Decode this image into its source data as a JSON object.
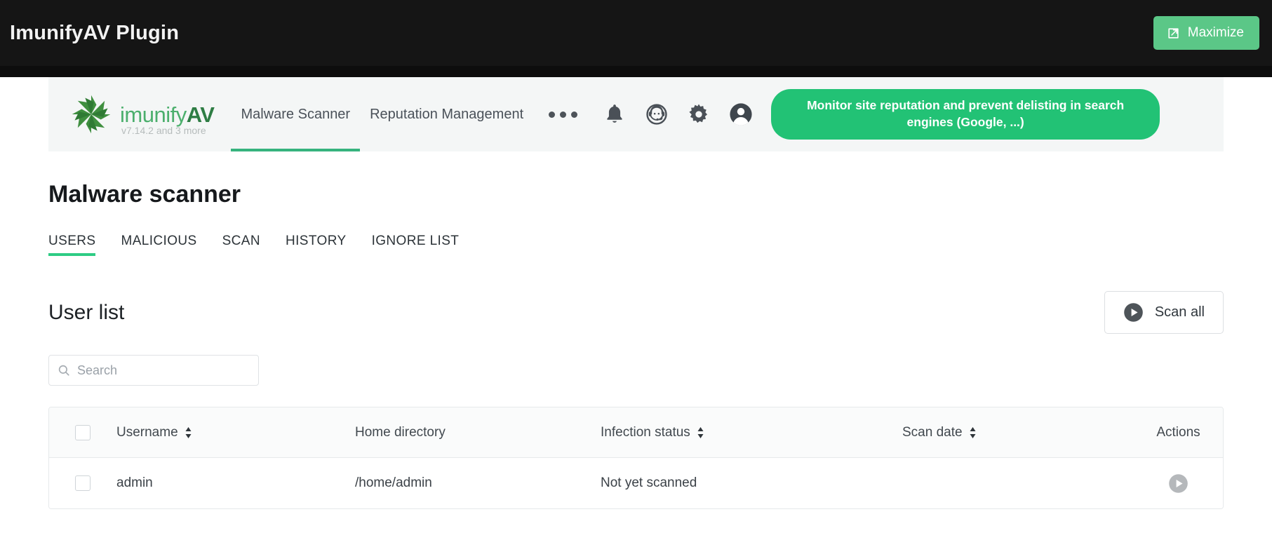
{
  "window": {
    "title": "ImunifyAV Plugin",
    "maximize_label": "Maximize",
    "maximize_icon": "expand-icon",
    "bar_bg": "#151515",
    "accent": "#5bc787"
  },
  "app_header": {
    "logo": {
      "mark_icon": "imunify-pinwheel-logo",
      "name_primary": "imunify",
      "name_secondary": "AV",
      "version": "v7.14.2 and 3 more",
      "primary_color": "#4caf6d",
      "secondary_color": "#2e7d44"
    },
    "nav": [
      {
        "label": "Malware Scanner",
        "active": true
      },
      {
        "label": "Reputation Management",
        "active": false
      }
    ],
    "more_icon": "ellipsis-icon",
    "icons": [
      {
        "name": "bell-icon"
      },
      {
        "name": "support-headset-icon"
      },
      {
        "name": "gear-icon"
      },
      {
        "name": "user-avatar-icon"
      }
    ],
    "promo": {
      "text": "Monitor site reputation and prevent delisting in search engines (Google, ...)",
      "color": "#22c275"
    }
  },
  "main": {
    "page_title": "Malware scanner",
    "tabs": [
      {
        "label": "USERS",
        "active": true
      },
      {
        "label": "MALICIOUS",
        "active": false
      },
      {
        "label": "SCAN",
        "active": false
      },
      {
        "label": "HISTORY",
        "active": false
      },
      {
        "label": "IGNORE LIST",
        "active": false
      }
    ],
    "section_title": "User list",
    "scan_all": {
      "label": "Scan all",
      "icon": "play-circle-icon"
    },
    "search": {
      "value": "",
      "placeholder": "Search",
      "icon": "search-icon"
    },
    "table": {
      "columns": [
        {
          "key": "select",
          "label": "",
          "sortable": false
        },
        {
          "key": "username",
          "label": "Username",
          "sortable": true
        },
        {
          "key": "home",
          "label": "Home directory",
          "sortable": false
        },
        {
          "key": "status",
          "label": "Infection status",
          "sortable": true
        },
        {
          "key": "date",
          "label": "Scan date",
          "sortable": true
        },
        {
          "key": "actions",
          "label": "Actions",
          "sortable": false
        }
      ],
      "rows": [
        {
          "username": "admin",
          "home": "/home/admin",
          "status": "Not yet scanned",
          "date": "",
          "action_icon": "play-circle-icon"
        }
      ]
    }
  }
}
